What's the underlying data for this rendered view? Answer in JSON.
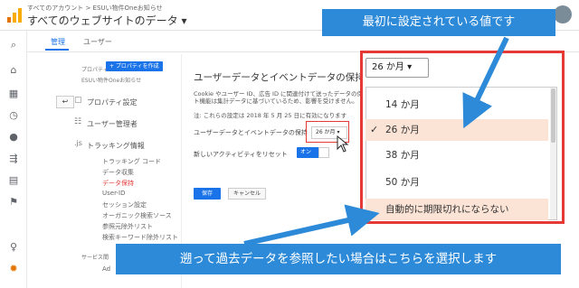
{
  "header": {
    "breadcrumbs": "すべてのアカウント > ESUい物件Oneお知らせ",
    "title": "すべてのウェブサイトのデータ ▾"
  },
  "tabs": [
    {
      "label": "管理"
    },
    {
      "label": "ユーザー"
    }
  ],
  "property": {
    "label": "プロパティ",
    "create_button": "+ プロパティを作成",
    "name": "ESUい物件Oneお知らせ",
    "menu": [
      {
        "label": "プロパティ設定",
        "icon": "document-icon"
      },
      {
        "label": "ユーザー管理者",
        "icon": "users-icon"
      },
      {
        "label": "トラッキング情報",
        "icon": "js-icon"
      }
    ],
    "submenu": [
      {
        "label": "トラッキング コード"
      },
      {
        "label": "データ収集"
      },
      {
        "label": "データ保持"
      },
      {
        "label": "User-ID"
      },
      {
        "label": "セッション設定"
      },
      {
        "label": "オーガニック検索ソース"
      },
      {
        "label": "参照元除外リスト"
      },
      {
        "label": "検索キーワード除外リスト"
      }
    ],
    "footer_label": "サービス間",
    "footer_item": "Ad"
  },
  "main": {
    "title": "ユーザーデータとイベントデータの保持",
    "desc_line1": "Cookie やユーザー ID、広告 ID に関連付けて送ったデータの保持",
    "desc_line2": "ト機能は集計データに基づいているため、影響を受けません。",
    "note": "注: これらの設定は 2018 年 5 月 25 日に有効になります",
    "retention_label": "ユーザーデータとイベントデータの保持",
    "retention_value": "26 か月 ▾",
    "reset_label": "新しいアクティビティをリセット",
    "toggle_label": "オン",
    "save_button": "保存",
    "cancel_button": "キャンセル"
  },
  "popup": {
    "selected_value": "26 か月 ▾",
    "options": [
      {
        "label": "14 か月"
      },
      {
        "label": "26 か月"
      },
      {
        "label": "38 か月"
      },
      {
        "label": "50 か月"
      },
      {
        "label": "自動的に期限切れにならない"
      }
    ],
    "check_mark": "✓"
  },
  "callouts": {
    "top": "最初に設定されている値です",
    "bottom": "遡って過去データを参照したい場合はこちらを選択します"
  },
  "colors": {
    "accent": "#1a73e8",
    "callout": "#2d8ad8",
    "highlight_frame": "#e53935",
    "option_highlight": "#fbe3d6"
  }
}
